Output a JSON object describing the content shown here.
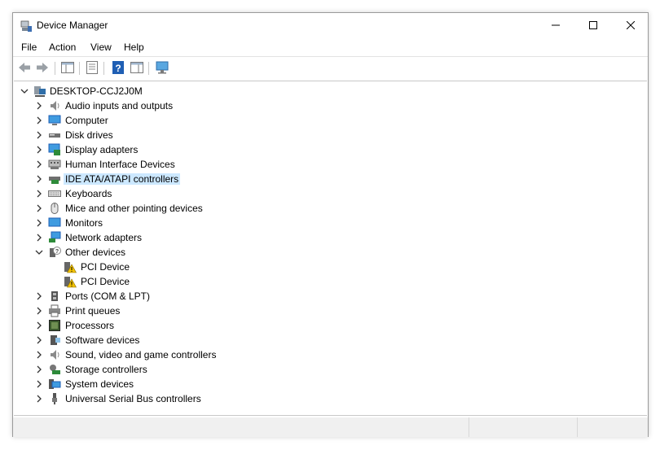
{
  "window": {
    "title": "Device Manager"
  },
  "menu": [
    "File",
    "Action",
    "View",
    "Help"
  ],
  "tree": {
    "root": "DESKTOP-CCJ2J0M",
    "items": [
      "Audio inputs and outputs",
      "Computer",
      "Disk drives",
      "Display adapters",
      "Human Interface Devices",
      "IDE ATA/ATAPI controllers",
      "Keyboards",
      "Mice and other pointing devices",
      "Monitors",
      "Network adapters",
      "Other devices",
      "PCI Device",
      "PCI Device",
      "Ports (COM & LPT)",
      "Print queues",
      "Processors",
      "Software devices",
      "Sound, video and game controllers",
      "Storage controllers",
      "System devices",
      "Universal Serial Bus controllers"
    ]
  }
}
